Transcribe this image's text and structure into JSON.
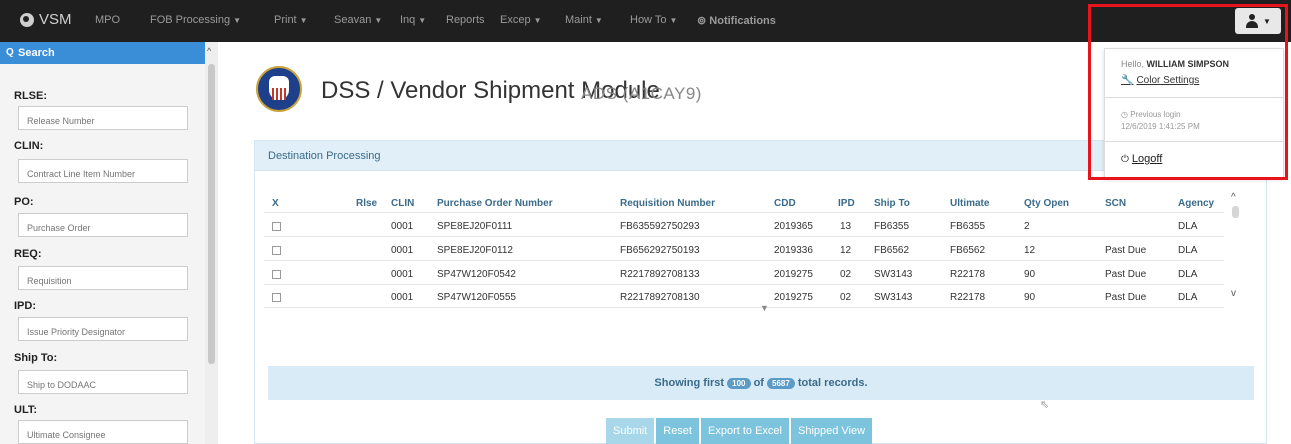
{
  "nav": {
    "brand": "VSM",
    "items": [
      {
        "label": "MPO",
        "caret": false
      },
      {
        "label": "FOB Processing",
        "caret": true
      },
      {
        "label": "Print",
        "caret": true
      },
      {
        "label": "Seavan",
        "caret": true
      },
      {
        "label": "Inq",
        "caret": true
      },
      {
        "label": "Reports",
        "caret": false
      },
      {
        "label": "Excep",
        "caret": true
      },
      {
        "label": "Maint",
        "caret": true
      },
      {
        "label": "How To",
        "caret": true
      }
    ],
    "notifications": "Notifications"
  },
  "sidebar": {
    "search_label": "Search",
    "fields": [
      {
        "label": "RLSE:",
        "placeholder": "Release Number"
      },
      {
        "label": "CLIN:",
        "placeholder": "Contract Line Item Number"
      },
      {
        "label": "PO:",
        "placeholder": "Purchase Order"
      },
      {
        "label": "REQ:",
        "placeholder": "Requisition"
      },
      {
        "label": "IPD:",
        "placeholder": "Issue Priority Designator"
      },
      {
        "label": "Ship To:",
        "placeholder": "Ship to DODAAC"
      },
      {
        "label": "ULT:",
        "placeholder": "Ultimate Consignee"
      }
    ]
  },
  "header": {
    "title": "DSS / Vendor Shipment Module",
    "subtitle": "ADS (A1CAY9)"
  },
  "panel": {
    "title": "Destination Processing"
  },
  "table": {
    "columns": [
      "X",
      "Rlse",
      "CLIN",
      "Purchase Order Number",
      "Requisition Number",
      "CDD",
      "IPD",
      "Ship To",
      "Ultimate",
      "Qty Open",
      "SCN",
      "Agency"
    ],
    "rows": [
      [
        "",
        "",
        "0001",
        "SPE8EJ20F0111",
        "FB635592750293",
        "2019365",
        "13",
        "FB6355",
        "FB6355",
        "2",
        "",
        "DLA"
      ],
      [
        "",
        "",
        "0001",
        "SPE8EJ20F0112",
        "FB656292750193",
        "2019336",
        "12",
        "FB6562",
        "FB6562",
        "12",
        "Past Due",
        "DLA"
      ],
      [
        "",
        "",
        "0001",
        "SP47W120F0542",
        "R2217892708133",
        "2019275",
        "02",
        "SW3143",
        "R22178",
        "90",
        "Past Due",
        "DLA"
      ],
      [
        "",
        "",
        "0001",
        "SP47W120F0555",
        "R2217892708130",
        "2019275",
        "02",
        "SW3143",
        "R22178",
        "90",
        "Past Due",
        "DLA"
      ]
    ]
  },
  "records": {
    "prefix": "Showing first",
    "shown": "100",
    "middle": "of",
    "total": "5687",
    "suffix": "total records."
  },
  "buttons": {
    "submit": "Submit",
    "reset": "Reset",
    "export": "Export to Excel",
    "shipped": "Shipped View"
  },
  "user_menu": {
    "hello": "Hello,",
    "user_name": "WILLIAM SIMPSON",
    "color_settings": "Color Settings",
    "previous_login_label": "Previous login",
    "previous_login_value": "12/6/2019 1:41:25 PM",
    "logoff": "Logoff"
  },
  "colors": {
    "navbar": "#1f1f1f",
    "accent": "#3a8ed8",
    "highlight": "#e8141b"
  }
}
